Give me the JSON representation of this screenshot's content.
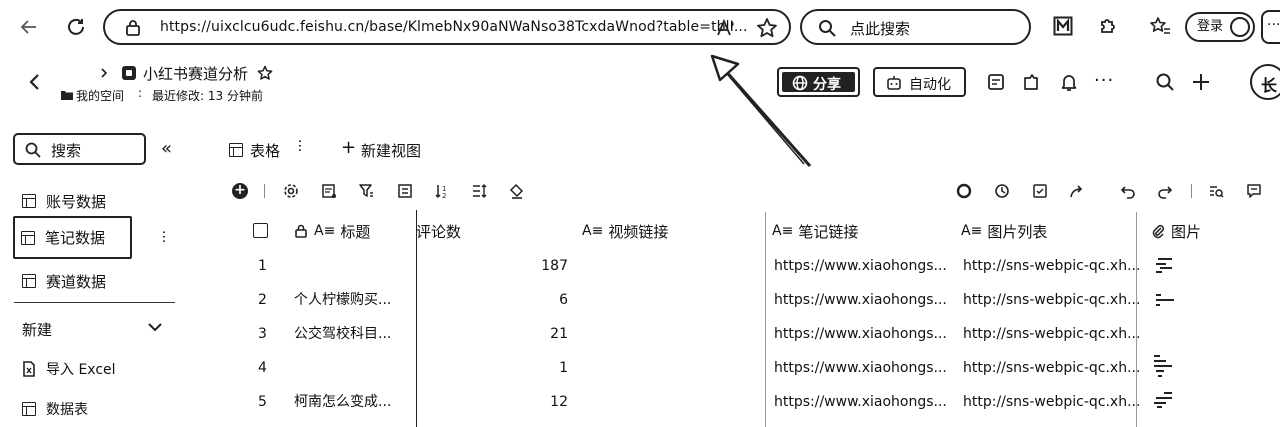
{
  "browser": {
    "url": "https://uixclcu6udc.feishu.cn/base/KlmebNx90aNWaNso38TcxdaWnod?table=tblI...",
    "search_placeholder": "点此搜索",
    "login_label": "登录"
  },
  "header": {
    "breadcrumb_space": "我的空间",
    "last_modified": "最近修改: 13 分钟前",
    "title": "小红书赛道分析",
    "share_label": "分享",
    "automation_label": "自动化",
    "avatar_text": "长"
  },
  "sidebar": {
    "search_label": "搜索",
    "items": [
      {
        "label": "账号数据"
      },
      {
        "label": "笔记数据"
      },
      {
        "label": "赛道数据"
      }
    ],
    "new_label": "新建",
    "import_label": "导入 Excel",
    "datatable_label": "数据表"
  },
  "views": {
    "current_view": "表格",
    "new_view_label": "新建视图"
  },
  "table": {
    "columns": [
      {
        "label": "标题"
      },
      {
        "label": "评论数"
      },
      {
        "label": "视频链接"
      },
      {
        "label": "笔记链接"
      },
      {
        "label": "图片列表"
      },
      {
        "label": "图片"
      }
    ],
    "rows": [
      {
        "idx": "1",
        "title": "",
        "comments": "187",
        "note_link": "https://www.xiaohongs...",
        "img_list": "http://sns-webpic-qc.xh..."
      },
      {
        "idx": "2",
        "title": "个人柠檬购买...",
        "comments": "6",
        "note_link": "https://www.xiaohongs...",
        "img_list": "http://sns-webpic-qc.xh..."
      },
      {
        "idx": "3",
        "title": "公交驾校科目...",
        "comments": "21",
        "note_link": "https://www.xiaohongs...",
        "img_list": "http://sns-webpic-qc.xh..."
      },
      {
        "idx": "4",
        "title": "",
        "comments": "1",
        "note_link": "https://www.xiaohongs...",
        "img_list": "http://sns-webpic-qc.xh..."
      },
      {
        "idx": "5",
        "title": "柯南怎么变成...",
        "comments": "12",
        "note_link": "https://www.xiaohongs...",
        "img_list": "http://sns-webpic-qc.xh..."
      }
    ]
  },
  "icons": {
    "back": "arrow-left-icon",
    "refresh": "refresh-icon",
    "lock": "lock-icon",
    "read_aloud": "read-aloud-icon",
    "favorite": "star-icon"
  }
}
